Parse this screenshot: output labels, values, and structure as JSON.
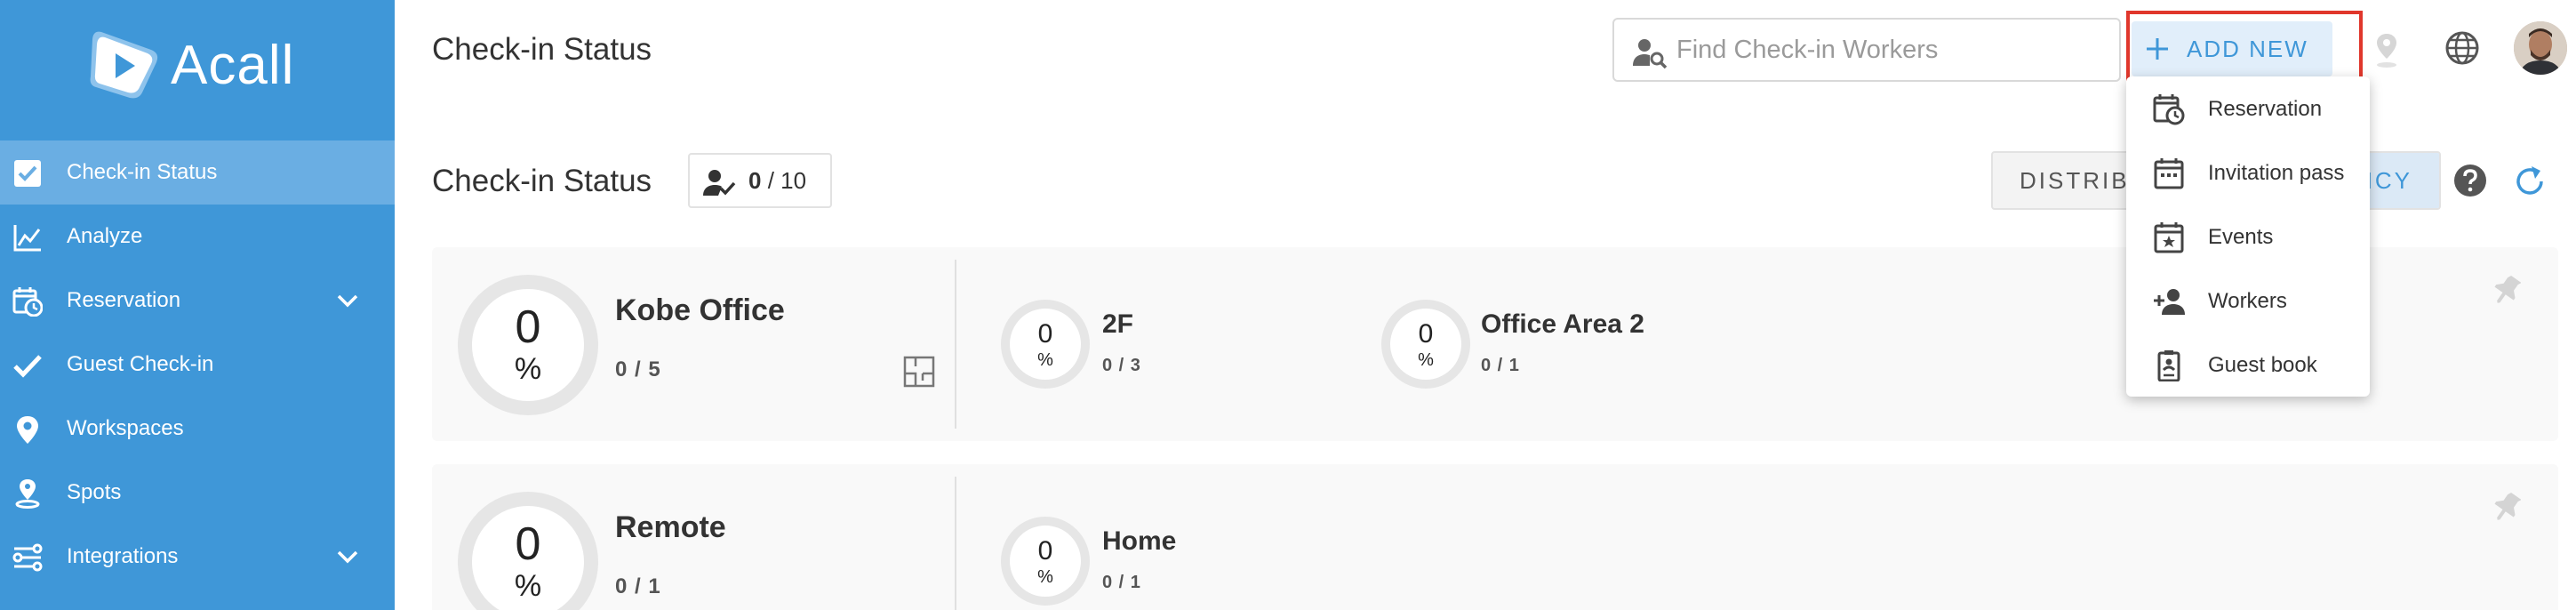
{
  "app": {
    "name": "Acall"
  },
  "sidebar": {
    "items": [
      {
        "label": "Check-in Status",
        "icon": "checkbox-icon",
        "active": true,
        "expandable": false
      },
      {
        "label": "Analyze",
        "icon": "line-chart-icon",
        "active": false,
        "expandable": false
      },
      {
        "label": "Reservation",
        "icon": "calendar-clock-icon",
        "active": false,
        "expandable": true
      },
      {
        "label": "Guest Check-in",
        "icon": "check-icon",
        "active": false,
        "expandable": false
      },
      {
        "label": "Workspaces",
        "icon": "location-pin-icon",
        "active": false,
        "expandable": false
      },
      {
        "label": "Spots",
        "icon": "spot-pin-icon",
        "active": false,
        "expandable": false
      },
      {
        "label": "Integrations",
        "icon": "integrations-icon",
        "active": false,
        "expandable": true
      }
    ]
  },
  "header": {
    "title": "Check-in Status",
    "search_placeholder": "Find Check-in Workers",
    "add_new_label": "ADD NEW"
  },
  "dropdown": {
    "items": [
      {
        "label": "Reservation",
        "icon": "calendar-clock-icon"
      },
      {
        "label": "Invitation pass",
        "icon": "calendar-icon"
      },
      {
        "label": "Events",
        "icon": "calendar-star-icon"
      },
      {
        "label": "Workers",
        "icon": "add-person-icon"
      },
      {
        "label": "Guest book",
        "icon": "guest-book-icon"
      }
    ]
  },
  "status": {
    "title": "Check-in Status",
    "checked_in": "0",
    "total": "/ 10",
    "view_left": "DISTRIBU",
    "view_right": "ANCY"
  },
  "sites": [
    {
      "name": "Kobe Office",
      "percent": "0",
      "pct_sign": "%",
      "count": "0 / 5",
      "areas": [
        {
          "name": "2F",
          "percent": "0",
          "pct_sign": "%",
          "count": "0 / 3"
        },
        {
          "name": "Office Area 2",
          "percent": "0",
          "pct_sign": "%",
          "count": "0 / 1"
        }
      ]
    },
    {
      "name": "Remote",
      "percent": "0",
      "pct_sign": "%",
      "count": "0 / 1",
      "areas": [
        {
          "name": "Home",
          "percent": "0",
          "pct_sign": "%",
          "count": "0 / 1"
        }
      ]
    }
  ],
  "colors": {
    "sidebar": "#3f97d8",
    "sidebar_active": "#6aaee3",
    "accent": "#3f97d8",
    "highlight": "#e0372c"
  }
}
